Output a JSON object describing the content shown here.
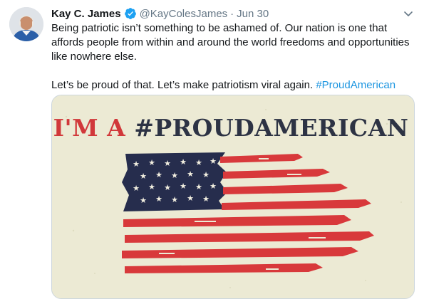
{
  "tweet": {
    "author_name": "Kay C. James",
    "handle": "@KayColesJames",
    "separator": "·",
    "date": "Jun 30",
    "text_line1": "Being patriotic isn’t something to be ashamed of. Our nation is one that affords people from within and around the world freedoms and opportunities like nowhere else.",
    "text_line2_prefix": "Let’s be proud of that. Let’s make patriotism viral again. ",
    "hashtag": "#ProudAmerican"
  },
  "media": {
    "image_heading_part1": "I'M A ",
    "image_heading_part2": "#PROUDAMERICAN",
    "heading_red": "#d1383a",
    "heading_navy": "#2d3344"
  },
  "colors": {
    "link": "#1b95e0",
    "verified": "#1da1f2",
    "muted": "#657786",
    "flag_red": "#d8393b",
    "flag_navy": "#262d4d",
    "card_bg": "#ecead4"
  },
  "icons": {
    "verified": "verified-badge-icon",
    "caret": "chevron-down-icon"
  }
}
